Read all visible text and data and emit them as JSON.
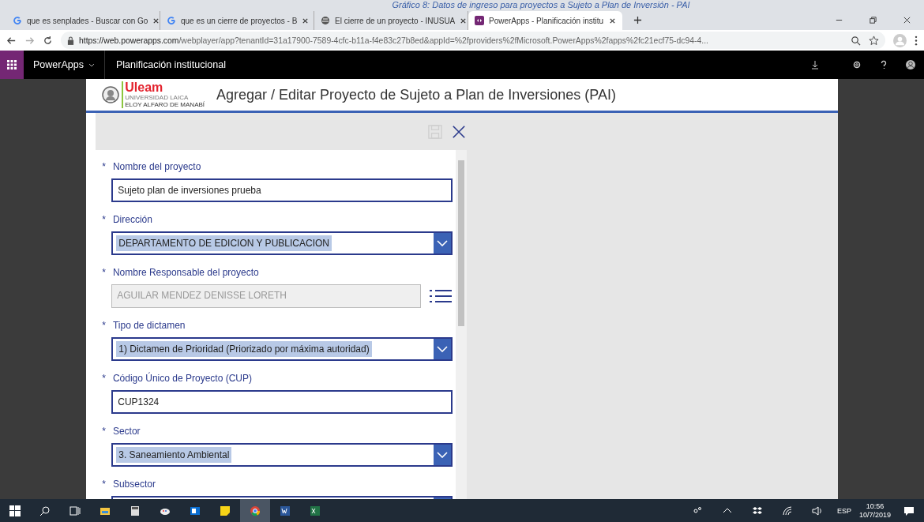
{
  "caption": "Gráfico 8: Datos de ingreso para proyectos a Sujeto a Plan de Inversión - PAI",
  "tabs": [
    {
      "label": "que es senplades - Buscar con Go",
      "kind": "search",
      "selected": false
    },
    {
      "label": "que es un cierre de proyectos - B",
      "kind": "search",
      "selected": false
    },
    {
      "label": "El cierre de un proyecto - INUSUA",
      "kind": "web",
      "selected": false
    },
    {
      "label": "PowerApps - Planificación institu",
      "kind": "app",
      "selected": true
    }
  ],
  "address": {
    "host": "https://web.powerapps.com",
    "path": "/webplayer/app?tenantId=31a17900-7589-4cfc-b11a-f4e83c27b8ed&appId=%2fproviders%2fMicrosoft.PowerApps%2fapps%2fc21ecf75-dc94-4..."
  },
  "app_bar": {
    "brand": "PowerApps",
    "app_name": "Planificación institucional"
  },
  "header": {
    "logo": "Uleam",
    "logo_line1": "UNIVERSIDAD LAICA",
    "logo_line2": "ELOY ALFARO DE MANABÍ",
    "title": "Agregar / Editar Proyecto de Sujeto a Plan de Inversiones (PAI)"
  },
  "fields": [
    {
      "kind": "text",
      "marker": "*",
      "label": "Nombre del proyecto",
      "value": "Sujeto plan de inversiones prueba",
      "disabled": false
    },
    {
      "kind": "dropdown",
      "marker": "*",
      "label": "Dirección",
      "value": "DEPARTAMENTO DE EDICION Y PUBLICACION",
      "disabled": false
    },
    {
      "kind": "lookup",
      "marker": "*",
      "label": "Nombre Responsable del proyecto",
      "value": "AGUILAR MENDEZ DENISSE LORETH",
      "disabled": true
    },
    {
      "kind": "dropdown",
      "marker": "*",
      "label": "Tipo de dictamen",
      "value": "1) Dictamen de Prioridad (Priorizado por máxima autoridad)",
      "disabled": false
    },
    {
      "kind": "text",
      "marker": "*",
      "label": "Código Único de Proyecto (CUP)",
      "value": "CUP1324",
      "disabled": false
    },
    {
      "kind": "dropdown",
      "marker": "*",
      "label": "Sector",
      "value": "3. Saneamiento Ambiental",
      "disabled": false
    },
    {
      "kind": "dropdown",
      "marker": "*",
      "label": "Subsector",
      "disabled": false
    }
  ],
  "tray": {
    "language": "ESP",
    "time": "10:56",
    "date": "10/7/2019"
  }
}
